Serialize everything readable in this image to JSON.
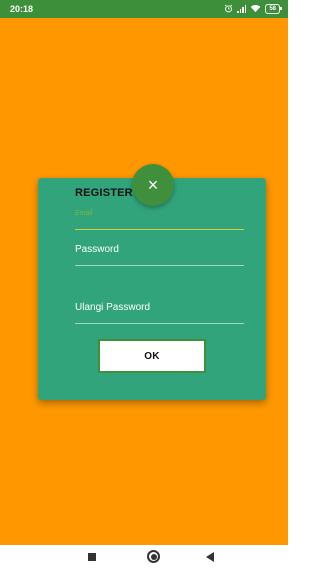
{
  "status_bar": {
    "time": "20:18",
    "icons": [
      "alarm-icon",
      "signal-icon",
      "wifi-icon",
      "battery-icon"
    ],
    "battery_level": "58"
  },
  "colors": {
    "status_bar": "#3d8f3a",
    "background": "#ff9800",
    "dialog": "#31a47c",
    "fab": "#3f8f3c",
    "accent_underline": "#c8d23e"
  },
  "dialog": {
    "close_symbol": "×",
    "title": "REGISTER",
    "fields": {
      "email": {
        "placeholder": "Email",
        "value": ""
      },
      "password": {
        "placeholder": "Password",
        "value": ""
      },
      "ulangi_password": {
        "placeholder": "Ulangi Password",
        "value": ""
      }
    },
    "ok_label": "OK"
  },
  "nav_bar": {
    "icons": [
      "recents-square-icon",
      "home-circle-icon",
      "back-triangle-icon"
    ]
  }
}
